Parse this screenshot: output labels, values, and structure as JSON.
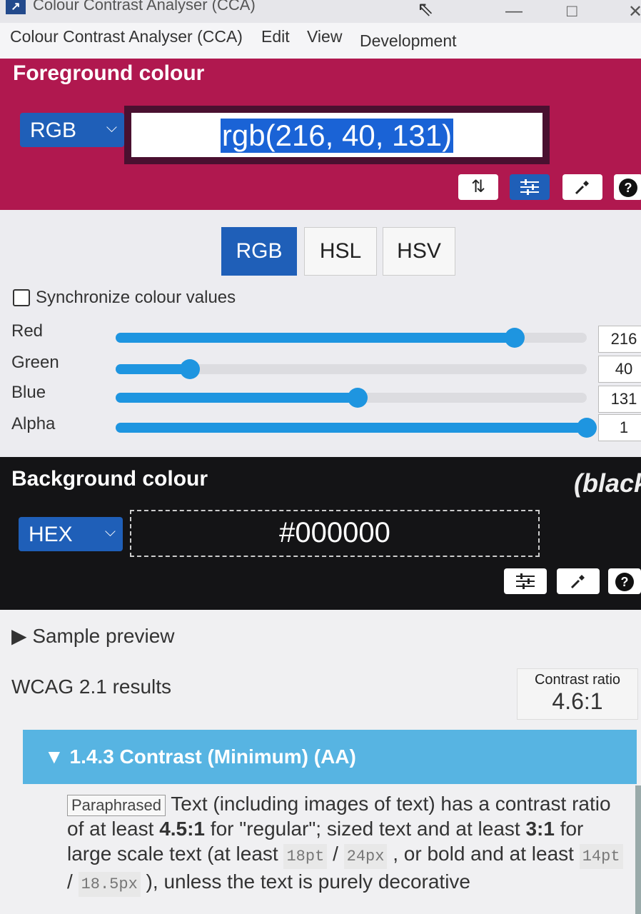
{
  "window": {
    "title": "Colour Contrast Analyser (CCA)",
    "icon": "cca-logo",
    "controls": {
      "minimize": "—",
      "maximize": "□",
      "close": "✕"
    }
  },
  "menu": [
    "Colour Contrast Analyser (CCA)",
    "Edit",
    "View",
    "Development"
  ],
  "foreground": {
    "title": "Foreground colour",
    "format": "RGB",
    "value": "rgb(216, 40, 131)",
    "color": "#d82883",
    "tools": {
      "swap": "⇅",
      "sliders": "sliders-icon",
      "picker": "eyedropper-icon",
      "help": "?"
    }
  },
  "colour_model_tabs": [
    "RGB",
    "HSL",
    "HSV"
  ],
  "active_tab": "RGB",
  "sync": {
    "label": "Synchronize colour values",
    "checked": false
  },
  "sliders": [
    {
      "label": "Red",
      "value": "216",
      "fraction": 0.847
    },
    {
      "label": "Green",
      "value": "40",
      "fraction": 0.157
    },
    {
      "label": "Blue",
      "value": "131",
      "fraction": 0.514
    },
    {
      "label": "Alpha",
      "value": "1",
      "fraction": 1.0
    }
  ],
  "background": {
    "title": "Background colour",
    "name": "(black",
    "format": "HEX",
    "value": "#000000",
    "color": "#000000",
    "tools": {
      "sliders": "sliders-icon",
      "picker": "eyedropper-icon",
      "help": "?"
    }
  },
  "sample_preview": "▶ Sample preview",
  "wcag": {
    "title": "WCAG 2.1 results",
    "ratio_label": "Contrast ratio",
    "ratio_value": "4.6:1",
    "criterion": "▼ 1.4.3 Contrast (Minimum) (AA)",
    "tag": "Paraphrased",
    "text_1": " Text (including images of text) has a contrast ratio of at least ",
    "bold_1": "4.5:1",
    "text_2": " for \"regular\"; sized text and at least ",
    "bold_2": "3:1",
    "text_3": " for large scale text (at least ",
    "code_1": "18pt",
    "sep_1": " / ",
    "code_2": "24px",
    "text_4": " , or bold and at least ",
    "code_3": "14pt",
    "sep_2": " / ",
    "code_4": "18.5px",
    "text_5": " ), unless the text is purely decorative"
  }
}
